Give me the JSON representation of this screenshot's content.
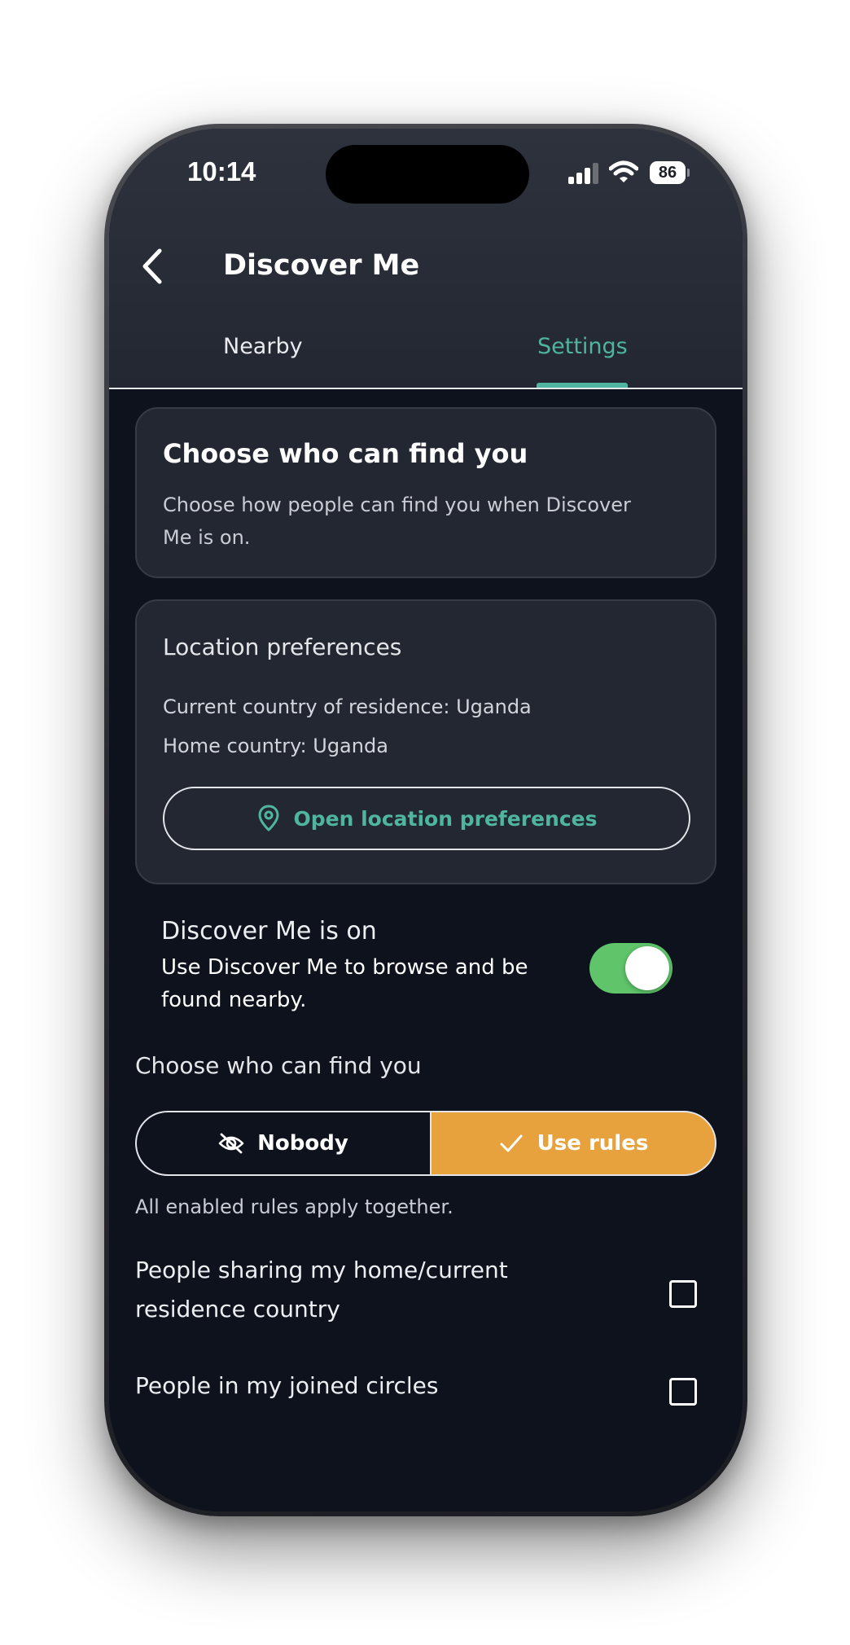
{
  "status_bar": {
    "time": "10:14",
    "battery": "86",
    "icons": [
      "signal-icon",
      "wifi-icon",
      "battery-icon"
    ]
  },
  "header": {
    "back_icon": "chevron-left-icon",
    "title": "Discover Me"
  },
  "tabs": [
    {
      "label": "Nearby",
      "active": false
    },
    {
      "label": "Settings",
      "active": true
    }
  ],
  "intro_card": {
    "title": "Choose who can find you",
    "description": "Choose how people can find you when Discover Me is on."
  },
  "location_card": {
    "heading": "Location preferences",
    "current_country": "Current country of residence: Uganda",
    "home_country": "Home country: Uganda",
    "button_label": "Open location preferences",
    "button_icon": "map-pin-icon"
  },
  "discover_toggle": {
    "title": "Discover Me is on",
    "description": "Use Discover Me to browse and be found nearby.",
    "enabled": true
  },
  "visibility": {
    "label": "Choose who can find you",
    "options": [
      {
        "label": "Nobody",
        "icon": "eye-off-icon",
        "selected": false
      },
      {
        "label": "Use rules",
        "icon": "check-icon",
        "selected": true
      }
    ],
    "hint": "All enabled rules apply together."
  },
  "rules": [
    {
      "label": "People sharing my home/current residence country",
      "checked": false
    },
    {
      "label": "People in my joined circles",
      "checked": false
    }
  ],
  "colors": {
    "accent_teal": "#4fb59e",
    "accent_orange": "#e8a23d",
    "toggle_green": "#5fc46a",
    "background": "#0d121d",
    "card": "#232731"
  }
}
